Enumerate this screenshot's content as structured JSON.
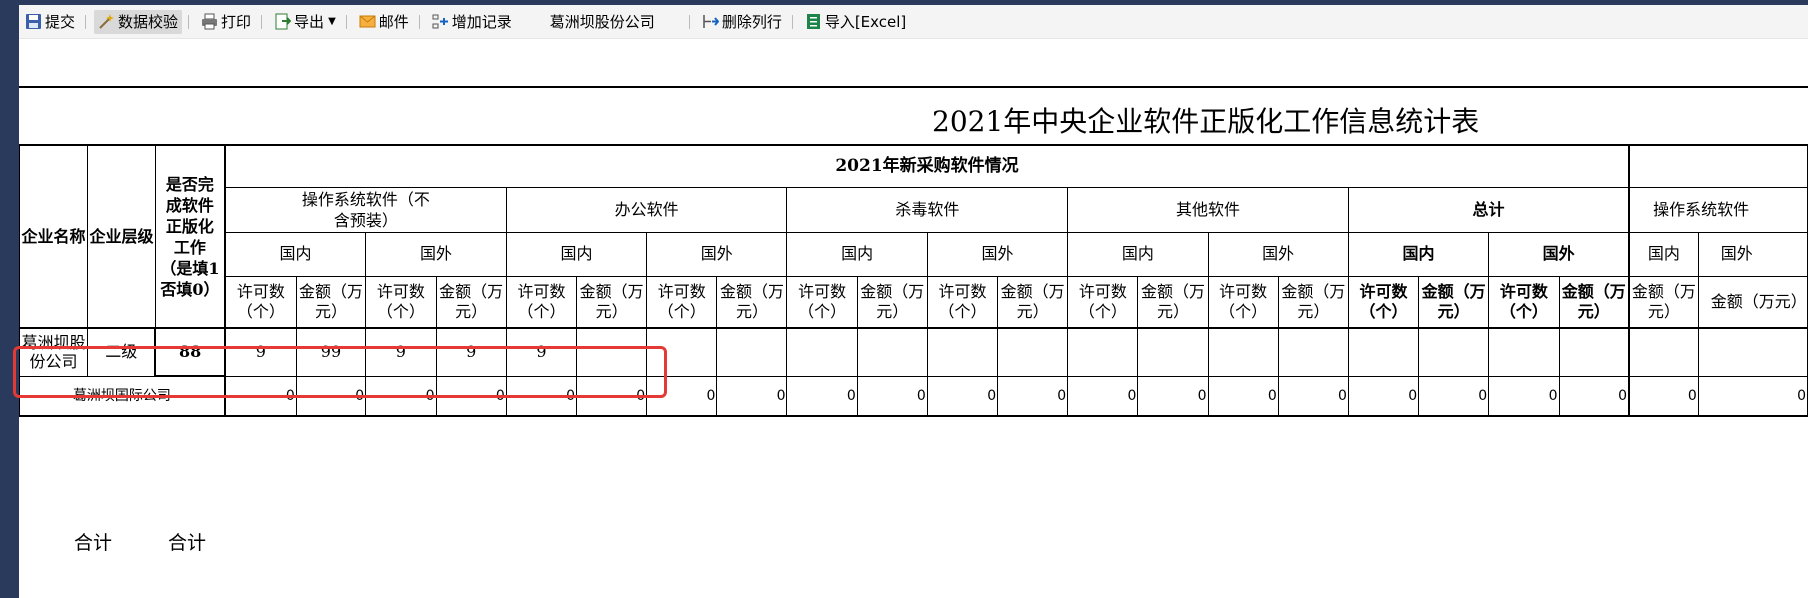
{
  "toolbar": {
    "submit": "提交",
    "validate": "数据校验",
    "print": "打印",
    "export": "导出",
    "mail": "邮件",
    "add_record": "增加记录",
    "company": "葛洲坝股份公司",
    "delete_row": "删除列行",
    "import_excel": "导入[Excel]"
  },
  "sheet": {
    "title": "2021年中央企业软件正版化工作信息统计表",
    "headers": {
      "company_name": "企业名称",
      "company_level": "企业层级",
      "completed": "是否完成软件正版化工作（是填1否填0）",
      "new_purchase": "2021年新采购软件情况",
      "os": "操作系统软件（不含预装）",
      "office": "办公软件",
      "antivirus": "杀毒软件",
      "other": "其他软件",
      "total": "总计",
      "os_next": "操作系统软件",
      "domestic": "国内",
      "foreign": "国外",
      "licenses": "许可数（个）",
      "amount": "金额（万元）"
    },
    "row1": {
      "name": "葛洲坝股份公司",
      "level": "二级",
      "completed": "88",
      "cells": [
        "9",
        "99",
        "9",
        "9",
        "9",
        "",
        "",
        "",
        "",
        "",
        "",
        "",
        "",
        "",
        "",
        "",
        "",
        "",
        "",
        "",
        "",
        "",
        ""
      ]
    },
    "row2": {
      "name": "葛洲坝国际公司",
      "cells": [
        "0",
        "0",
        "0",
        "0",
        "0",
        "0",
        "0",
        "0",
        "0",
        "0",
        "0",
        "0",
        "0",
        "0",
        "0",
        "0",
        "0",
        "0",
        "0",
        "0",
        "0",
        "0",
        "0"
      ]
    },
    "totals": {
      "label_a": "合计",
      "label_b": "合计"
    }
  }
}
